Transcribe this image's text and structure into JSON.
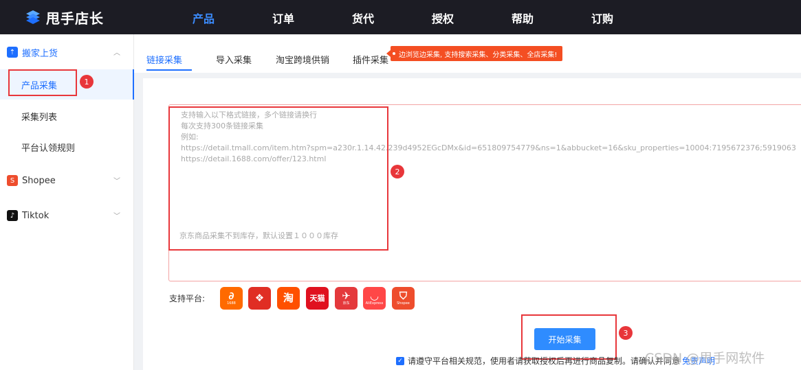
{
  "brand": {
    "name": "甩手店长"
  },
  "nav": [
    "产品",
    "订单",
    "货代",
    "授权",
    "帮助",
    "订购"
  ],
  "sidebar": {
    "groups": [
      {
        "label": "搬家上货",
        "icon": "upload-icon",
        "items": [
          "产品采集",
          "采集列表",
          "平台认领规则"
        ]
      },
      {
        "label": "Shopee",
        "icon": "shopee-icon"
      },
      {
        "label": "Tiktok",
        "icon": "tiktok-icon"
      }
    ]
  },
  "tabs": [
    "链接采集",
    "导入采集",
    "淘宝跨境供销",
    "插件采集"
  ],
  "promo": "边浏览边采集, 支持搜索采集、分类采集、全店采集!",
  "input": {
    "placeholder_lines": [
      "支持输入以下格式链接，多个链接请换行",
      "每次支持300条链接采集",
      "例如:",
      "https://detail.tmall.com/item.htm?spm=a230r.1.14.42.239d4952EGcDMx&id=651809754779&ns=1&abbucket=16&sku_properties=10004:7195672376;5919063:6536025",
      "https://detail.1688.com/offer/123.html"
    ],
    "note": "京东商品采集不到库存，默认设置１０００库存"
  },
  "platforms_label": "支持平台:",
  "platforms": [
    {
      "icon": "1688-icon",
      "glyph": "∂",
      "sub": "1688",
      "color": "#ff6a00"
    },
    {
      "icon": "pinduoduo-icon",
      "glyph": "❖",
      "sub": "",
      "color": "#e02e24"
    },
    {
      "icon": "taobao-icon",
      "glyph": "淘",
      "sub": "",
      "color": "#ff5000"
    },
    {
      "icon": "tmall-icon",
      "glyph": "天猫",
      "sub": "",
      "color": "#e0111f"
    },
    {
      "icon": "jd-icon",
      "glyph": "✈",
      "sub": "京东",
      "color": "#e4393c"
    },
    {
      "icon": "aliexpress-icon",
      "glyph": "◡",
      "sub": "AliExpress",
      "color": "#ff4747"
    },
    {
      "icon": "shopee-platform-icon",
      "glyph": "⛉",
      "sub": "Shopee",
      "color": "#ee4d2d"
    }
  ],
  "start_button": "开始采集",
  "agreement": {
    "text": "请遵守平台相关规范，使用者请获取授权后再进行商品复制。请确认并同意",
    "link": "免责声明"
  },
  "badges": [
    "1",
    "2",
    "3"
  ],
  "watermark": "CSDN @甩手网软件"
}
